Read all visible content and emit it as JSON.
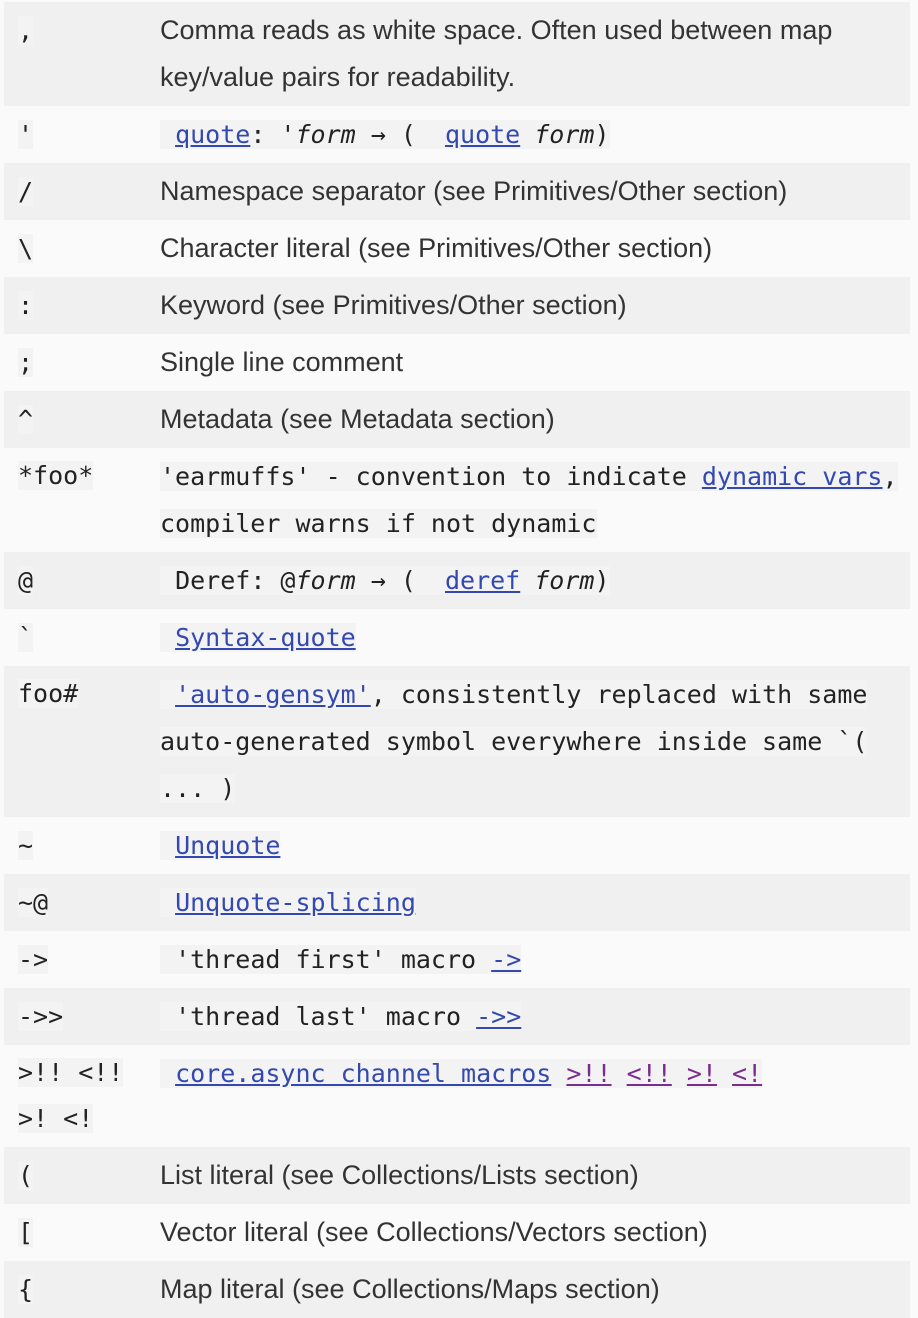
{
  "rows": [
    {
      "sym": ",",
      "desc": "Comma reads as white space. Often used between map key/value pairs for readability."
    },
    {
      "sym": "'",
      "quote_link": "quote",
      "quote_pre": ": '",
      "quote_form": "form",
      "quote_arrow": " → ( ",
      "quote_link2": "quote",
      "quote_form2": "form",
      "quote_close": ")"
    },
    {
      "sym": "/",
      "desc": "Namespace separator (see Primitives/Other section)"
    },
    {
      "sym": "\\",
      "desc": "Character literal (see Primitives/Other section)"
    },
    {
      "sym": ":",
      "desc": "Keyword (see Primitives/Other section)"
    },
    {
      "sym": ";",
      "desc": "Single line comment"
    },
    {
      "sym": "^",
      "desc": "Metadata (see Metadata section)"
    },
    {
      "sym": "*foo*",
      "desc_pre": "'earmuffs' - convention to indicate ",
      "link": "dynamic vars",
      "desc_post": ", compiler warns if not dynamic"
    },
    {
      "sym": "@",
      "deref_pre": "Deref: @",
      "deref_form": "form",
      "deref_arrow": " → ( ",
      "deref_link": "deref",
      "deref_form2": "form",
      "deref_close": ")"
    },
    {
      "sym": "`",
      "link": "Syntax-quote"
    },
    {
      "sym": "foo#",
      "link": "'auto-gensym'",
      "desc_post": ", consistently replaced with same auto-generated symbol everywhere inside same `( ... )"
    },
    {
      "sym": "~",
      "link": "Unquote"
    },
    {
      "sym": "~@",
      "link": "Unquote-splicing"
    },
    {
      "sym": "->",
      "desc_pre": "'thread first' macro ",
      "link": "->"
    },
    {
      "sym": "->>",
      "desc_pre": "'thread last' macro ",
      "link": "->>"
    },
    {
      "sym": ">!! <!! >! <!",
      "link": "core.async channel macros",
      "links2": [
        ">!!",
        "<!!",
        ">!",
        "<!"
      ]
    },
    {
      "sym": "(",
      "desc": "List literal (see Collections/Lists section)"
    },
    {
      "sym": "[",
      "desc": "Vector literal (see Collections/Vectors section)"
    },
    {
      "sym": "{",
      "desc": "Map literal (see Collections/Maps section)"
    }
  ],
  "colors": {
    "link": "#3348b0",
    "visited_link": "#7a2c8f",
    "stripe": "#f0f0f0"
  }
}
